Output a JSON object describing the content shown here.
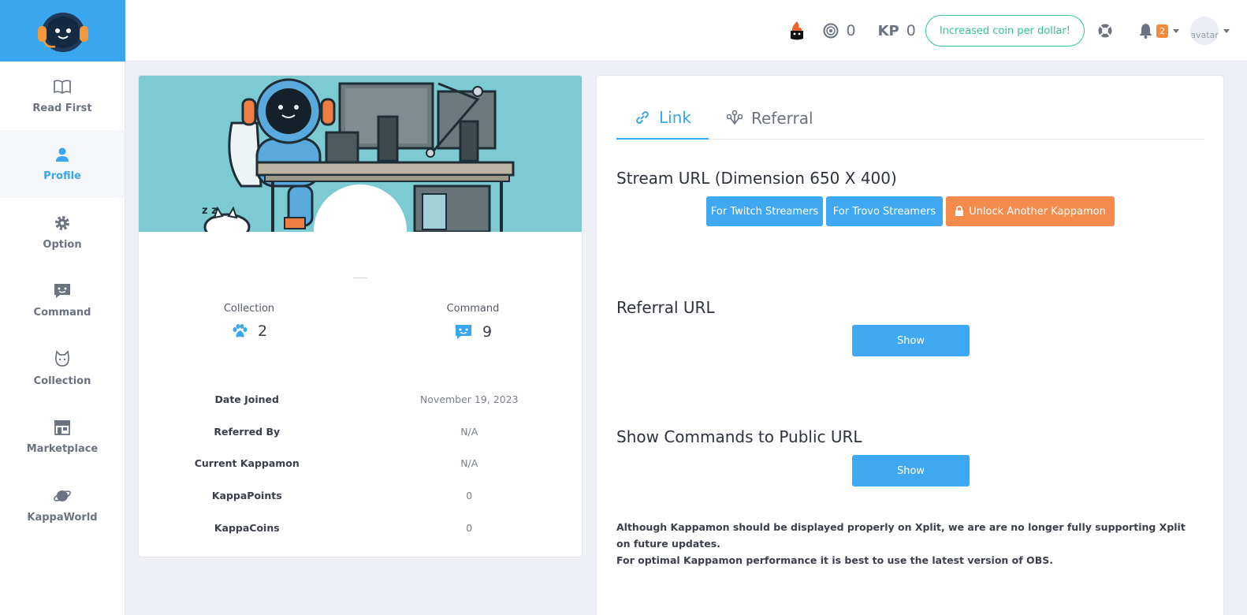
{
  "sidebar": {
    "items": [
      {
        "label": "Read First",
        "icon": "book-icon",
        "active": false
      },
      {
        "label": "Profile",
        "icon": "user-icon",
        "active": true
      },
      {
        "label": "Option",
        "icon": "gear-icon",
        "active": false
      },
      {
        "label": "Command",
        "icon": "chat-icon",
        "active": false
      },
      {
        "label": "Collection",
        "icon": "cat-icon",
        "active": false
      },
      {
        "label": "Marketplace",
        "icon": "shop-icon",
        "active": false
      },
      {
        "label": "KappaWorld",
        "icon": "planet-icon",
        "active": false
      }
    ]
  },
  "header": {
    "coins": "0",
    "kp_label": "KP",
    "kp_value": "0",
    "promo": "Increased coin per dollar!",
    "notification_count": "2",
    "avatar_alt": "avatar"
  },
  "profile": {
    "stats": {
      "collection_label": "Collection",
      "collection_value": "2",
      "command_label": "Command",
      "command_value": "9"
    },
    "info": [
      {
        "key": "Date Joined",
        "value": "November 19, 2023"
      },
      {
        "key": "Referred By",
        "value": "N/A"
      },
      {
        "key": "Current Kappamon",
        "value": "N/A"
      },
      {
        "key": "KappaPoints",
        "value": "0"
      },
      {
        "key": "KappaCoins",
        "value": "0"
      }
    ]
  },
  "main": {
    "tabs": [
      {
        "label": "Link",
        "active": true
      },
      {
        "label": "Referral",
        "active": false
      }
    ],
    "stream_title": "Stream URL (Dimension 650 X 400)",
    "twitch_btn": "For Twitch Streamers",
    "trovo_btn": "For Trovo Streamers",
    "unlock_btn": "Unlock Another Kappamon",
    "referral_title": "Referral URL",
    "referral_show": "Show",
    "commands_title": "Show Commands to Public URL",
    "commands_show": "Show",
    "note_line1": "Although Kappamon should be displayed properly on Xplit, we are are no longer fully supporting Xplit on future updates.",
    "note_line2": "For optimal Kappamon performance it is best to use the latest version of OBS."
  },
  "colors": {
    "accent": "#3aa6ee",
    "promo": "#34c38f",
    "orange": "#f58a4d"
  }
}
